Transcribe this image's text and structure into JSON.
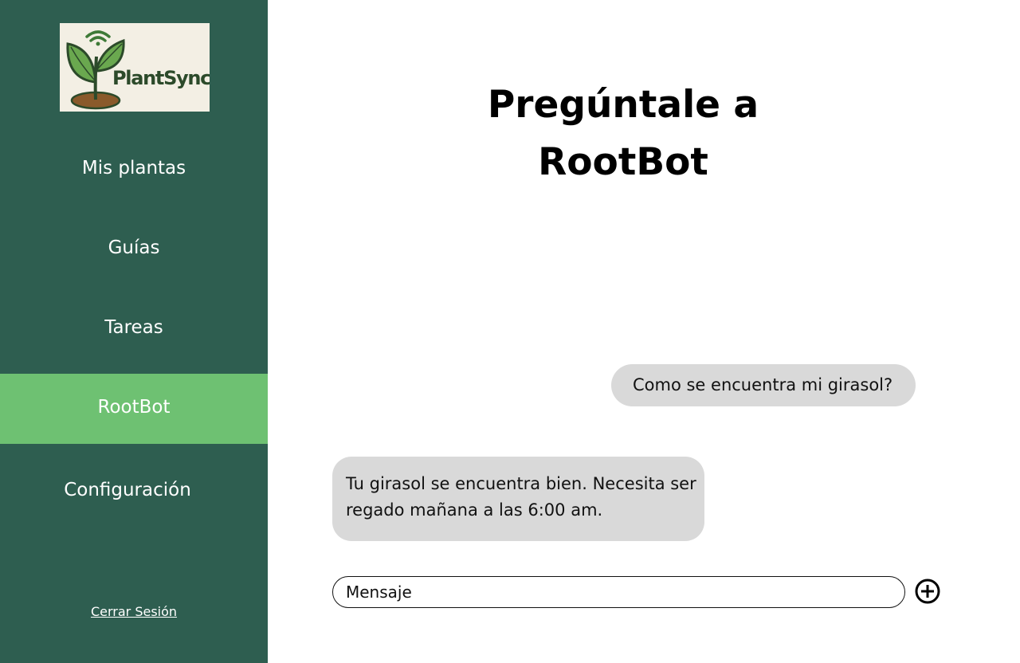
{
  "brand": {
    "logo_text": "PlantSync"
  },
  "sidebar": {
    "items": [
      {
        "label": "Mis plantas",
        "active": false
      },
      {
        "label": "Guías",
        "active": false
      },
      {
        "label": "Tareas",
        "active": false
      },
      {
        "label": "RootBot",
        "active": true
      },
      {
        "label": "Configuración",
        "active": false
      }
    ],
    "logout_label": "Cerrar Sesión"
  },
  "main": {
    "title_line1": "Pregúntale a",
    "title_line2": "RootBot",
    "messages": [
      {
        "from": "user",
        "text": "Como se encuentra mi girasol?"
      },
      {
        "from": "bot",
        "text": "Tu girasol se encuentra bien. Necesita ser regado mañana a las 6:00 am."
      }
    ],
    "input": {
      "placeholder": "Mensaje",
      "value": ""
    },
    "send_icon": "plus-circle-icon"
  },
  "colors": {
    "sidebar_bg": "#2e5e50",
    "active_item_bg": "#6ec172",
    "bubble_bg": "#d9d9d9",
    "logo_bg": "#f3efe4"
  }
}
